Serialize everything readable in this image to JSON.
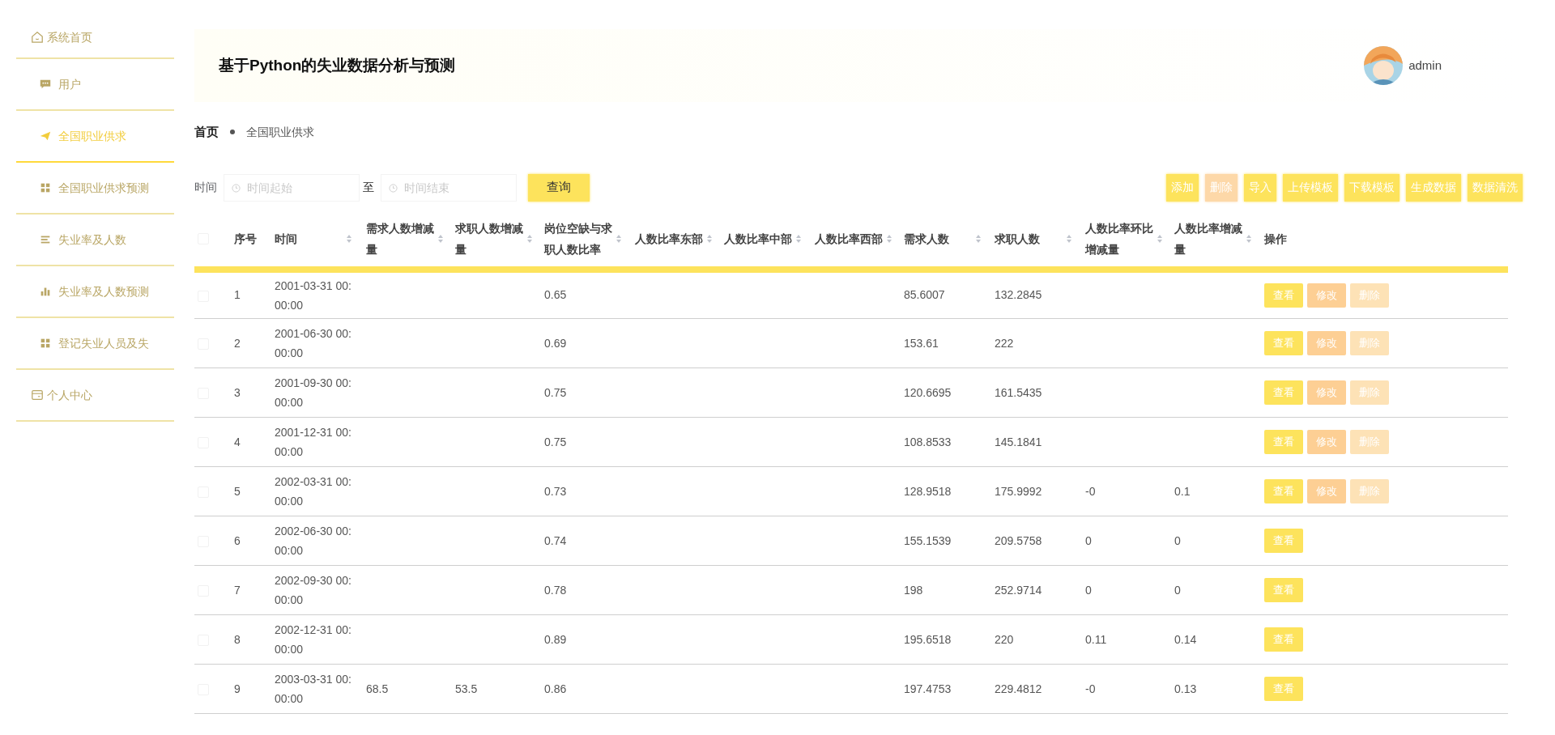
{
  "sidebar": {
    "items": [
      {
        "label": "系统首页",
        "kind": "section",
        "selected": false
      },
      {
        "label": "用户",
        "kind": "menu",
        "selected": false
      },
      {
        "label": "全国职业供求",
        "kind": "menu",
        "selected": true
      },
      {
        "label": "全国职业供求预测",
        "kind": "menu",
        "selected": false
      },
      {
        "label": "失业率及人数",
        "kind": "menu",
        "selected": false
      },
      {
        "label": "失业率及人数预测",
        "kind": "menu",
        "selected": false
      },
      {
        "label": "登记失业人员及失",
        "kind": "menu",
        "selected": false
      },
      {
        "label": "个人中心",
        "kind": "section",
        "selected": false
      }
    ]
  },
  "header": {
    "title": "基于Python的失业数据分析与预测",
    "user": {
      "name": "admin"
    }
  },
  "breadcrumb": [
    "首页",
    "全国职业供求"
  ],
  "search": {
    "label": "时间",
    "start": {
      "placeholder": "时间起始"
    },
    "separator": "至",
    "end": {
      "placeholder": "时间结束"
    },
    "button": "查询"
  },
  "toolbar": [
    {
      "label": "添加",
      "kind": "primary"
    },
    {
      "label": "删除",
      "kind": "danger"
    },
    {
      "label": "导入",
      "kind": "primary"
    },
    {
      "label": "上传模板",
      "kind": "primary"
    },
    {
      "label": "下载模板",
      "kind": "primary"
    },
    {
      "label": "生成数据",
      "kind": "primary"
    },
    {
      "label": "数据清洗",
      "kind": "primary"
    }
  ],
  "table": {
    "select_all": {
      "checked": false
    },
    "columns": [
      {
        "label": "序号",
        "sortable": false
      },
      {
        "label": "时间",
        "sortable": true
      },
      {
        "label": "需求人数增减量",
        "sortable": true
      },
      {
        "label": "求职人数增减量",
        "sortable": true
      },
      {
        "label": "岗位空缺与求职人数比率",
        "sortable": true
      },
      {
        "label": "人数比率东部",
        "sortable": true
      },
      {
        "label": "人数比率中部",
        "sortable": true
      },
      {
        "label": "人数比率西部",
        "sortable": true
      },
      {
        "label": "需求人数",
        "sortable": true
      },
      {
        "label": "求职人数",
        "sortable": true
      },
      {
        "label": "人数比率环比增减量",
        "sortable": true
      },
      {
        "label": "人数比率增减量",
        "sortable": true
      },
      {
        "label": "操作",
        "sortable": false
      }
    ],
    "rows": [
      {
        "checked": false,
        "cells": [
          "1",
          "2001-03-31 00:00:00",
          "",
          "",
          "0.65",
          "",
          "",
          "",
          "85.6007",
          "132.2845",
          "",
          ""
        ],
        "actions": [
          {
            "label": "查看",
            "kind": "view"
          },
          {
            "label": "修改",
            "kind": "edit"
          },
          {
            "label": "删除",
            "kind": "delete"
          }
        ]
      },
      {
        "checked": false,
        "cells": [
          "2",
          "2001-06-30 00:00:00",
          "",
          "",
          "0.69",
          "",
          "",
          "",
          "153.61",
          "222",
          "",
          ""
        ],
        "actions": [
          {
            "label": "查看",
            "kind": "view"
          },
          {
            "label": "修改",
            "kind": "edit"
          },
          {
            "label": "删除",
            "kind": "delete"
          }
        ]
      },
      {
        "checked": false,
        "cells": [
          "3",
          "2001-09-30 00:00:00",
          "",
          "",
          "0.75",
          "",
          "",
          "",
          "120.6695",
          "161.5435",
          "",
          ""
        ],
        "actions": [
          {
            "label": "查看",
            "kind": "view"
          },
          {
            "label": "修改",
            "kind": "edit"
          },
          {
            "label": "删除",
            "kind": "delete"
          }
        ]
      },
      {
        "checked": false,
        "cells": [
          "4",
          "2001-12-31 00:00:00",
          "",
          "",
          "0.75",
          "",
          "",
          "",
          "108.8533",
          "145.1841",
          "",
          ""
        ],
        "actions": [
          {
            "label": "查看",
            "kind": "view"
          },
          {
            "label": "修改",
            "kind": "edit"
          },
          {
            "label": "删除",
            "kind": "delete"
          }
        ]
      },
      {
        "checked": false,
        "cells": [
          "5",
          "2002-03-31 00:00:00",
          "",
          "",
          "0.73",
          "",
          "",
          "",
          "128.9518",
          "175.9992",
          "-0",
          "0.1"
        ],
        "actions": [
          {
            "label": "查看",
            "kind": "view"
          },
          {
            "label": "修改",
            "kind": "edit"
          },
          {
            "label": "删除",
            "kind": "delete"
          }
        ]
      },
      {
        "checked": false,
        "cells": [
          "6",
          "2002-06-30 00:00:00",
          "",
          "",
          "0.74",
          "",
          "",
          "",
          "155.1539",
          "209.5758",
          "0",
          "0"
        ],
        "actions": [
          {
            "label": "查看",
            "kind": "view"
          }
        ]
      },
      {
        "checked": false,
        "cells": [
          "7",
          "2002-09-30 00:00:00",
          "",
          "",
          "0.78",
          "",
          "",
          "",
          "198",
          "252.9714",
          "0",
          "0"
        ],
        "actions": [
          {
            "label": "查看",
            "kind": "view"
          }
        ]
      },
      {
        "checked": false,
        "cells": [
          "8",
          "2002-12-31 00:00:00",
          "",
          "",
          "0.89",
          "",
          "",
          "",
          "195.6518",
          "220",
          "0.11",
          "0.14"
        ],
        "actions": [
          {
            "label": "查看",
            "kind": "view"
          }
        ]
      },
      {
        "checked": false,
        "cells": [
          "9",
          "2003-03-31 00:00:00",
          "68.5",
          "53.5",
          "0.86",
          "",
          "",
          "",
          "197.4753",
          "229.4812",
          "-0",
          "0.13"
        ],
        "actions": [
          {
            "label": "查看",
            "kind": "view"
          }
        ]
      }
    ]
  }
}
